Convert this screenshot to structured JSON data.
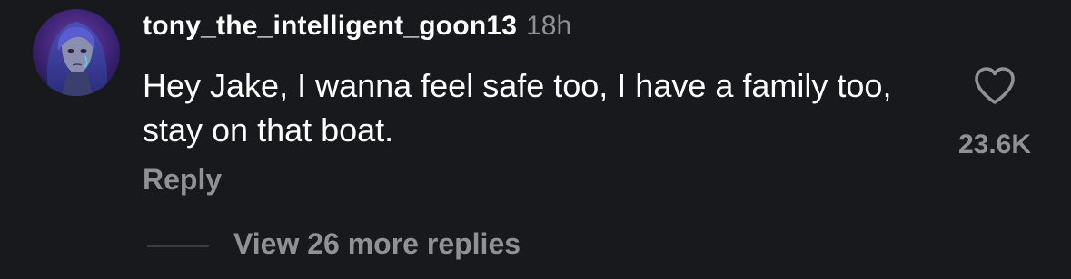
{
  "comment": {
    "username": "tony_the_intelligent_goon13",
    "timestamp": "18h",
    "text": "Hey Jake, I wanna feel safe too, I have a family too, stay on that boat.",
    "reply_label": "Reply",
    "likes": "23.6K",
    "like_icon": "heart-outline-icon",
    "view_replies_label": "View 26 more replies"
  },
  "colors": {
    "background": "#17191c",
    "primary_text": "#ffffff",
    "secondary_text": "#8e9196"
  }
}
